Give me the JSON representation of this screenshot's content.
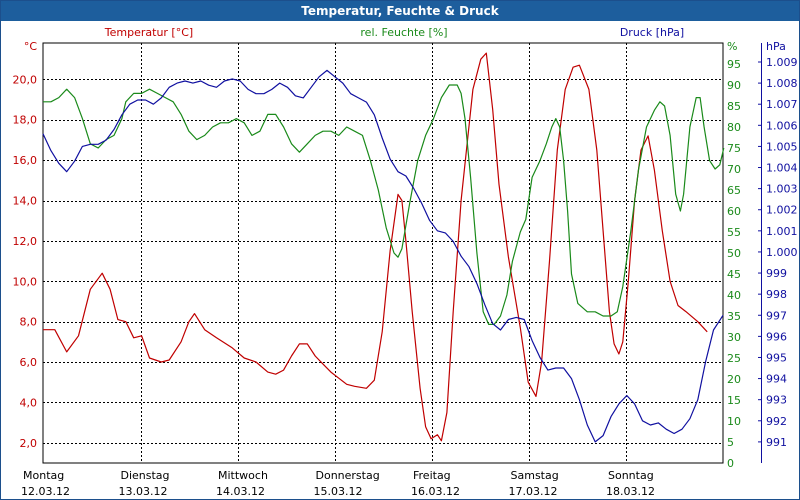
{
  "window": {
    "title": "Temperatur, Feuchte & Druck"
  },
  "colors": {
    "temperature": "#c00000",
    "humidity": "#1a8a1a",
    "pressure": "#1010a0",
    "grid": "#000000",
    "title_bar": "#1d5e9d"
  },
  "chart_data": {
    "type": "line",
    "title": "Temperatur, Feuchte & Druck",
    "grid": true,
    "days": [
      {
        "name": "Montag",
        "date": "12.03.12"
      },
      {
        "name": "Dienstag",
        "date": "13.03.12"
      },
      {
        "name": "Mittwoch",
        "date": "14.03.12"
      },
      {
        "name": "Donnerstag",
        "date": "15.03.12"
      },
      {
        "name": "Freitag",
        "date": "16.03.12"
      },
      {
        "name": "Samstag",
        "date": "17.03.12"
      },
      {
        "name": "Sonntag",
        "date": "18.03.12"
      }
    ],
    "x_range_days": [
      0,
      7
    ],
    "axes": {
      "temperature": {
        "label": "Temperatur [°C]",
        "unit": "°C",
        "range": [
          1.0,
          21.8
        ],
        "ticks": [
          "2,0",
          "4,0",
          "6,0",
          "8,0",
          "10,0",
          "12,0",
          "14,0",
          "16,0",
          "18,0",
          "20,0"
        ]
      },
      "humidity": {
        "label": "rel. Feuchte [%]",
        "unit": "%",
        "range": [
          0,
          100
        ],
        "ticks": [
          "0",
          "5",
          "10",
          "15",
          "20",
          "25",
          "30",
          "35",
          "40",
          "45",
          "50",
          "55",
          "60",
          "65",
          "70",
          "75",
          "80",
          "85",
          "90",
          "95"
        ]
      },
      "pressure": {
        "label": "Druck [hPa]",
        "unit": "hPa",
        "range": [
          990.0,
          1009.9
        ],
        "ticks": [
          "991",
          "992",
          "993",
          "994",
          "995",
          "996",
          "997",
          "998",
          "999",
          "1.000",
          "1.001",
          "1.002",
          "1.003",
          "1.004",
          "1.005",
          "1.006",
          "1.007",
          "1.008",
          "1.009"
        ]
      }
    },
    "series": [
      {
        "name": "Temperatur [°C]",
        "axis": "temperature",
        "points": [
          [
            0,
            7.6
          ],
          [
            0.15,
            7.6
          ],
          [
            0.3,
            6.5
          ],
          [
            0.45,
            7.3
          ],
          [
            0.6,
            9.6
          ],
          [
            0.75,
            10.4
          ],
          [
            0.85,
            9.6
          ],
          [
            0.95,
            8.1
          ],
          [
            1.05,
            8.0
          ],
          [
            1.15,
            7.2
          ],
          [
            1.25,
            7.3
          ],
          [
            1.35,
            6.2
          ],
          [
            1.5,
            6.0
          ],
          [
            1.6,
            6.1
          ],
          [
            1.75,
            7.0
          ],
          [
            1.85,
            8.0
          ],
          [
            1.92,
            8.4
          ],
          [
            2.05,
            7.6
          ],
          [
            2.2,
            7.2
          ],
          [
            2.4,
            6.7
          ],
          [
            2.55,
            6.2
          ],
          [
            2.7,
            6.0
          ],
          [
            2.85,
            5.5
          ],
          [
            2.95,
            5.4
          ],
          [
            3.05,
            5.6
          ],
          [
            3.15,
            6.3
          ],
          [
            3.25,
            6.9
          ],
          [
            3.35,
            6.9
          ],
          [
            3.45,
            6.3
          ],
          [
            3.55,
            5.9
          ],
          [
            3.65,
            5.5
          ],
          [
            3.75,
            5.2
          ],
          [
            3.85,
            4.9
          ],
          [
            3.95,
            4.8
          ],
          [
            4.1,
            4.7
          ],
          [
            4.2,
            5.1
          ],
          [
            4.3,
            7.5
          ],
          [
            4.4,
            11.5
          ],
          [
            4.5,
            14.3
          ],
          [
            4.55,
            14.0
          ],
          [
            4.6,
            12.0
          ],
          [
            4.68,
            8.5
          ],
          [
            4.78,
            4.7
          ],
          [
            4.85,
            2.8
          ],
          [
            4.92,
            2.2
          ],
          [
            5.0,
            2.4
          ],
          [
            5.05,
            2.1
          ],
          [
            5.12,
            3.5
          ],
          [
            5.2,
            8.5
          ],
          [
            5.3,
            14.0
          ],
          [
            5.45,
            19.5
          ],
          [
            5.55,
            21.0
          ],
          [
            5.62,
            21.3
          ],
          [
            5.7,
            18.5
          ],
          [
            5.78,
            14.8
          ],
          [
            5.9,
            11.2
          ],
          [
            6.05,
            7.7
          ],
          [
            6.15,
            5.0
          ],
          [
            6.25,
            4.3
          ],
          [
            6.32,
            6.0
          ],
          [
            6.42,
            11.0
          ],
          [
            6.52,
            16.5
          ],
          [
            6.62,
            19.5
          ],
          [
            6.72,
            20.6
          ],
          [
            6.8,
            20.7
          ],
          [
            6.92,
            19.5
          ],
          [
            7.02,
            16.5
          ],
          [
            7.1,
            12.5
          ],
          [
            7.18,
            8.5
          ],
          [
            7.24,
            6.9
          ],
          [
            7.3,
            6.4
          ],
          [
            7.35,
            7.0
          ],
          [
            7.42,
            10.0
          ],
          [
            7.5,
            14.0
          ],
          [
            7.58,
            16.5
          ],
          [
            7.67,
            17.2
          ],
          [
            7.75,
            15.5
          ],
          [
            7.85,
            12.5
          ],
          [
            7.95,
            10.0
          ],
          [
            8.05,
            8.8
          ],
          [
            8.15,
            8.5
          ],
          [
            8.3,
            8.0
          ],
          [
            8.42,
            7.5
          ]
        ]
      },
      {
        "name": "rel. Feuchte [%]",
        "axis": "humidity",
        "points": [
          [
            0,
            86
          ],
          [
            0.1,
            86
          ],
          [
            0.2,
            87
          ],
          [
            0.3,
            89
          ],
          [
            0.4,
            87
          ],
          [
            0.5,
            82
          ],
          [
            0.6,
            76
          ],
          [
            0.7,
            75
          ],
          [
            0.8,
            77
          ],
          [
            0.9,
            78
          ],
          [
            1.0,
            82
          ],
          [
            1.05,
            86
          ],
          [
            1.15,
            88
          ],
          [
            1.25,
            88
          ],
          [
            1.35,
            89
          ],
          [
            1.45,
            88
          ],
          [
            1.55,
            87
          ],
          [
            1.65,
            86
          ],
          [
            1.75,
            83
          ],
          [
            1.85,
            79
          ],
          [
            1.95,
            77
          ],
          [
            2.05,
            78
          ],
          [
            2.15,
            80
          ],
          [
            2.25,
            81
          ],
          [
            2.35,
            81
          ],
          [
            2.45,
            82
          ],
          [
            2.55,
            81
          ],
          [
            2.65,
            78
          ],
          [
            2.75,
            79
          ],
          [
            2.85,
            83
          ],
          [
            2.95,
            83
          ],
          [
            3.05,
            80
          ],
          [
            3.15,
            76
          ],
          [
            3.25,
            74
          ],
          [
            3.35,
            76
          ],
          [
            3.45,
            78
          ],
          [
            3.55,
            79
          ],
          [
            3.65,
            79
          ],
          [
            3.75,
            78
          ],
          [
            3.85,
            80
          ],
          [
            3.95,
            79
          ],
          [
            4.05,
            78
          ],
          [
            4.15,
            72
          ],
          [
            4.25,
            65
          ],
          [
            4.35,
            56
          ],
          [
            4.45,
            50
          ],
          [
            4.5,
            49
          ],
          [
            4.55,
            51
          ],
          [
            4.65,
            62
          ],
          [
            4.75,
            72
          ],
          [
            4.85,
            78
          ],
          [
            4.95,
            82
          ],
          [
            5.05,
            87
          ],
          [
            5.15,
            90
          ],
          [
            5.25,
            90
          ],
          [
            5.3,
            88
          ],
          [
            5.35,
            82
          ],
          [
            5.42,
            68
          ],
          [
            5.5,
            50
          ],
          [
            5.58,
            36
          ],
          [
            5.65,
            33
          ],
          [
            5.72,
            33
          ],
          [
            5.8,
            35
          ],
          [
            5.88,
            40
          ],
          [
            5.95,
            48
          ],
          [
            6.05,
            55
          ],
          [
            6.12,
            58
          ],
          [
            6.2,
            68
          ],
          [
            6.3,
            72
          ],
          [
            6.38,
            76
          ],
          [
            6.45,
            80
          ],
          [
            6.5,
            82
          ],
          [
            6.55,
            80
          ],
          [
            6.6,
            72
          ],
          [
            6.65,
            60
          ],
          [
            6.7,
            45
          ],
          [
            6.78,
            38
          ],
          [
            6.9,
            36
          ],
          [
            7.0,
            36
          ],
          [
            7.1,
            35
          ],
          [
            7.2,
            35
          ],
          [
            7.28,
            36
          ],
          [
            7.35,
            42
          ],
          [
            7.45,
            55
          ],
          [
            7.55,
            70
          ],
          [
            7.65,
            80
          ],
          [
            7.75,
            84
          ],
          [
            7.82,
            86
          ],
          [
            7.88,
            85
          ],
          [
            7.95,
            78
          ],
          [
            8.02,
            64
          ],
          [
            8.08,
            60
          ],
          [
            8.12,
            64
          ],
          [
            8.2,
            80
          ],
          [
            8.28,
            87
          ],
          [
            8.33,
            87
          ],
          [
            8.38,
            80
          ],
          [
            8.45,
            72
          ],
          [
            8.52,
            70
          ],
          [
            8.58,
            71
          ],
          [
            8.63,
            75
          ]
        ]
      },
      {
        "name": "Druck [hPa]",
        "axis": "pressure",
        "points": [
          [
            0,
            1005.6
          ],
          [
            0.1,
            1004.8
          ],
          [
            0.2,
            1004.2
          ],
          [
            0.3,
            1003.8
          ],
          [
            0.4,
            1004.3
          ],
          [
            0.5,
            1005.0
          ],
          [
            0.6,
            1005.1
          ],
          [
            0.7,
            1005.1
          ],
          [
            0.8,
            1005.3
          ],
          [
            0.9,
            1005.8
          ],
          [
            1.0,
            1006.5
          ],
          [
            1.1,
            1007.0
          ],
          [
            1.2,
            1007.2
          ],
          [
            1.3,
            1007.2
          ],
          [
            1.4,
            1007.0
          ],
          [
            1.5,
            1007.3
          ],
          [
            1.6,
            1007.8
          ],
          [
            1.7,
            1008.0
          ],
          [
            1.8,
            1008.1
          ],
          [
            1.9,
            1008.0
          ],
          [
            2.0,
            1008.1
          ],
          [
            2.1,
            1007.9
          ],
          [
            2.2,
            1007.8
          ],
          [
            2.3,
            1008.1
          ],
          [
            2.4,
            1008.2
          ],
          [
            2.5,
            1008.1
          ],
          [
            2.6,
            1007.7
          ],
          [
            2.7,
            1007.5
          ],
          [
            2.8,
            1007.5
          ],
          [
            2.9,
            1007.7
          ],
          [
            3.0,
            1008.0
          ],
          [
            3.1,
            1007.8
          ],
          [
            3.2,
            1007.4
          ],
          [
            3.3,
            1007.3
          ],
          [
            3.4,
            1007.8
          ],
          [
            3.5,
            1008.3
          ],
          [
            3.6,
            1008.6
          ],
          [
            3.7,
            1008.3
          ],
          [
            3.8,
            1008.0
          ],
          [
            3.9,
            1007.5
          ],
          [
            4.0,
            1007.3
          ],
          [
            4.1,
            1007.1
          ],
          [
            4.2,
            1006.5
          ],
          [
            4.3,
            1005.4
          ],
          [
            4.4,
            1004.4
          ],
          [
            4.5,
            1003.8
          ],
          [
            4.6,
            1003.6
          ],
          [
            4.7,
            1003.0
          ],
          [
            4.8,
            1002.3
          ],
          [
            4.9,
            1001.5
          ],
          [
            5.0,
            1001.0
          ],
          [
            5.1,
            1000.9
          ],
          [
            5.2,
            1000.5
          ],
          [
            5.3,
            999.8
          ],
          [
            5.4,
            999.3
          ],
          [
            5.5,
            998.5
          ],
          [
            5.6,
            997.5
          ],
          [
            5.7,
            996.6
          ],
          [
            5.8,
            996.3
          ],
          [
            5.9,
            996.8
          ],
          [
            6.0,
            996.9
          ],
          [
            6.1,
            996.8
          ],
          [
            6.2,
            995.8
          ],
          [
            6.3,
            995.0
          ],
          [
            6.4,
            994.4
          ],
          [
            6.5,
            994.5
          ],
          [
            6.6,
            994.5
          ],
          [
            6.7,
            994.0
          ],
          [
            6.8,
            993.0
          ],
          [
            6.9,
            991.8
          ],
          [
            7.0,
            991.0
          ],
          [
            7.1,
            991.3
          ],
          [
            7.2,
            992.2
          ],
          [
            7.3,
            992.8
          ],
          [
            7.4,
            993.2
          ],
          [
            7.5,
            992.8
          ],
          [
            7.6,
            992.0
          ],
          [
            7.7,
            991.8
          ],
          [
            7.8,
            991.9
          ],
          [
            7.9,
            991.6
          ],
          [
            8.0,
            991.4
          ],
          [
            8.1,
            991.6
          ],
          [
            8.2,
            992.1
          ],
          [
            8.3,
            993.0
          ],
          [
            8.4,
            994.8
          ],
          [
            8.5,
            996.3
          ],
          [
            8.62,
            997.0
          ]
        ]
      }
    ]
  }
}
